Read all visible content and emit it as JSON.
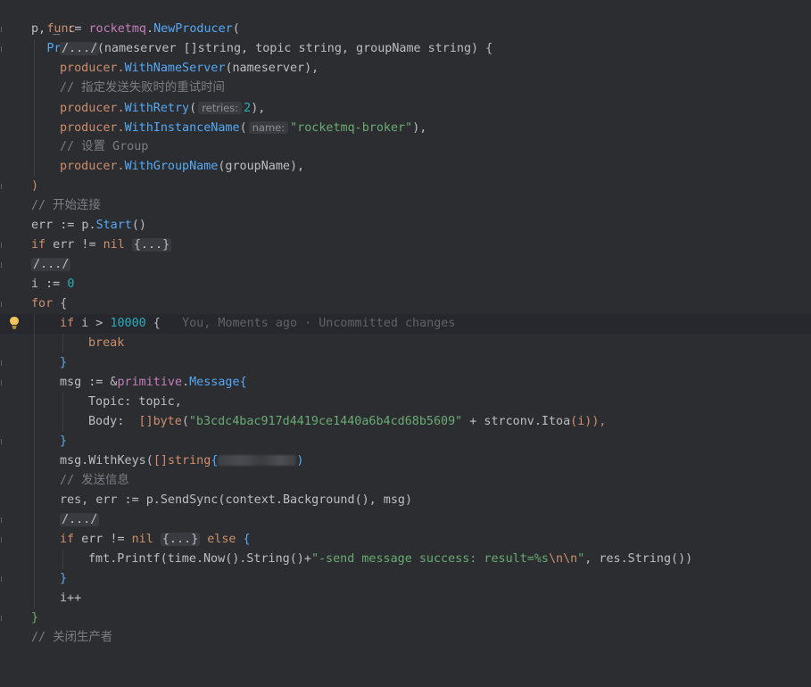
{
  "editor": {
    "lines": {
      "l1": {
        "kw": "func",
        "name": "Produce",
        "params": "(nameserver []string, topic string, groupName string) {"
      },
      "l2": {
        "a": "p, _ := ",
        "pkg": "rocketmq",
        "dot": ".",
        "fn": "NewProducer",
        "rest": "("
      },
      "l3": {
        "fold": "/.../"
      },
      "l4": {
        "a": "producer.",
        "fn": "WithNameServer",
        "rest": "(nameserver),"
      },
      "l5": {
        "comment": "// 指定发送失败时的重试时间"
      },
      "l6": {
        "a": "producer.",
        "fn": "WithRetry",
        "open": "(",
        "hint": "retries:",
        "num": "2",
        "rest": "),"
      },
      "l7": {
        "a": "producer.",
        "fn": "WithInstanceName",
        "open": "(",
        "hint": "name:",
        "str": "\"rocketmq-broker\"",
        "rest": "),"
      },
      "l8": {
        "comment": "// 设置 Group"
      },
      "l9": {
        "a": "producer.",
        "fn": "WithGroupName",
        "rest": "(groupName),"
      },
      "l10": {
        "a": ")"
      },
      "l11": {
        "comment": "// 开始连接"
      },
      "l12": {
        "a": "err := p.",
        "fn": "Start",
        "rest": "()"
      },
      "l13": {
        "kw": "if",
        "a": " err != ",
        "kw2": "nil",
        "fold": "{...}"
      },
      "l14": {
        "fold": "/.../"
      },
      "l15": {
        "a": "i := ",
        "num": "0"
      },
      "l16": {
        "kw": "for",
        "rest": " {"
      },
      "l17": {
        "kw": "if",
        "a": " i > ",
        "num": "10000",
        "rest": " {",
        "blame": "You, Moments ago · Uncommitted changes"
      },
      "l18": {
        "kw": "break"
      },
      "l19": {
        "a": "}"
      },
      "l20": {
        "a": "msg := &",
        "pkg": "primitive",
        "dot": ".",
        "type": "Message",
        "rest": "{"
      },
      "l21": {
        "a": "Topic: topic,"
      },
      "l22": {
        "a": "Body:  ",
        "bracket": "[]",
        "kw": "byte",
        "open": "(",
        "str": "\"b3cdc4bac917d4419ce1440a6b4cd68b5609\"",
        "plus": " + ",
        "pkg": "strconv",
        "dot": ".",
        "fn": "Itoa",
        "rest": "(i)),"
      },
      "l23": {
        "a": "}"
      },
      "l24": {
        "a": "msg.",
        "fn": "WithKeys",
        "open": "(",
        "bracket": "[]",
        "kw": "string",
        "brace": "{",
        "close": ")"
      },
      "l25": {
        "comment": "// 发送信息"
      },
      "l26": {
        "a": "res, err := p.",
        "fn": "SendSync",
        "open": "(",
        "pkg": "context",
        "dot": ".",
        "fn2": "Background",
        "rest": "(), msg)"
      },
      "l27": {
        "fold": "/.../"
      },
      "l28": {
        "kw": "if",
        "a": " err != ",
        "kw2": "nil",
        "fold": "{...}",
        "kw3": "else",
        "rest": " {"
      },
      "l29": {
        "pkg": "fmt",
        "dot": ".",
        "fn": "Printf",
        "open": "(",
        "pkg2": "time",
        "dot2": ".",
        "fn2": "Now",
        "mid": "().",
        "fn3": "String",
        "mid2": "()+",
        "str": "\"-send message success: result=%s",
        "esc": "\\n\\n",
        "strend": "\"",
        "sep": ", res.",
        "fn4": "String",
        "rest": "())"
      },
      "l30": {
        "a": "}"
      },
      "l31": {
        "a": "i++"
      },
      "l32": {
        "a": "}"
      },
      "l33": {
        "comment": "// 关闭生产者"
      }
    }
  },
  "colors": {
    "background": "#2b2d30",
    "keyword": "#cf8e6d",
    "function": "#57aaf7",
    "package": "#c77dbb",
    "string": "#6aab73",
    "number": "#2aacb8",
    "comment": "#7a7e85"
  }
}
